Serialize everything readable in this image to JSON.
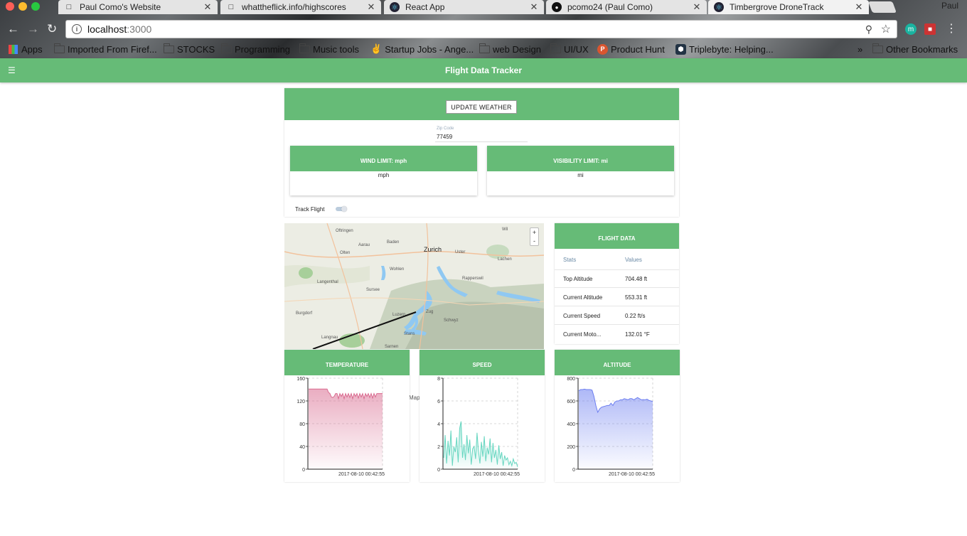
{
  "browser": {
    "tabs": [
      {
        "title": "Paul Como's Website",
        "icon": "page-icon"
      },
      {
        "title": "whattheflick.info/highscores",
        "icon": "page-icon"
      },
      {
        "title": "React App",
        "icon": "react-icon"
      },
      {
        "title": "pcomo24 (Paul Como)",
        "icon": "github-icon"
      },
      {
        "title": "Timbergrove DroneTrack",
        "icon": "react-icon"
      }
    ],
    "profile": "Paul",
    "url_host": "localhost",
    "url_port": ":3000",
    "bookmarks": [
      {
        "label": "Apps"
      },
      {
        "label": "Imported From Firef..."
      },
      {
        "label": "STOCKS"
      },
      {
        "label": "Programming"
      },
      {
        "label": "Music tools"
      },
      {
        "label": "Startup Jobs - Ange..."
      },
      {
        "label": "web Design"
      },
      {
        "label": "UI/UX"
      },
      {
        "label": "Product Hunt"
      },
      {
        "label": "Triplebyte: Helping..."
      },
      {
        "label": "»"
      },
      {
        "label": "Other Bookmarks"
      }
    ]
  },
  "app": {
    "title": "Flight Data Tracker",
    "update_button": "UPDATE WEATHER",
    "zip_label": "Zip Code",
    "zip_value": "77459",
    "wind_limit": {
      "title": "WIND LIMIT: mph",
      "unit": "mph"
    },
    "visibility_limit": {
      "title": "VISIBILITY LIMIT: mi",
      "unit": "mi"
    },
    "track_flight": "Track Flight",
    "map": {
      "zoom_in": "+",
      "zoom_out": "-",
      "attribution": "Map",
      "labels": [
        "Zurich",
        "Olten",
        "Aarau",
        "Baden",
        "Wohlen",
        "Sursee",
        "Luzern",
        "Zug",
        "Burgdorf",
        "Langnau",
        "Sarnen",
        "Schwyz",
        "Stans",
        "Uster",
        "Rapperswil",
        "Oftringen",
        "Langenthal",
        "Wil",
        "Lachen"
      ]
    },
    "flight_data": {
      "title": "FLIGHT DATA",
      "columns": [
        "Stats",
        "Values"
      ],
      "rows": [
        {
          "stat": "Top Altitude",
          "value": "704.48 ft"
        },
        {
          "stat": "Current Altitude",
          "value": "553.31 ft"
        },
        {
          "stat": "Current Speed",
          "value": "0.22 ft/s"
        },
        {
          "stat": "Current Moto...",
          "value": "132.01 °F"
        }
      ]
    },
    "temperature_title": "TEMPERATURE",
    "speed_title": "SPEED",
    "altitude_title": "ALTITUDE",
    "colors": {
      "primary": "#66bb77",
      "temp": "#d96a8f",
      "speed": "#66d6c0",
      "altitude": "#6c7ef0"
    }
  },
  "chart_data": [
    {
      "type": "area",
      "title": "TEMPERATURE",
      "x_label_single": "2017-08-10 00:42:55",
      "yticks": [
        0,
        40,
        80,
        120,
        160
      ],
      "ylim": [
        0,
        160
      ],
      "values": [
        141,
        141,
        141,
        141,
        141,
        141,
        141,
        141,
        141,
        141,
        141,
        141,
        141,
        141,
        135,
        133,
        127,
        126,
        128,
        133,
        133,
        124,
        133,
        128,
        133,
        124,
        133,
        127,
        133,
        126,
        133,
        124,
        133,
        128,
        133,
        125,
        133,
        127,
        133,
        124,
        133,
        128,
        133,
        126,
        133,
        125,
        133,
        127,
        133,
        133,
        133,
        133,
        133
      ]
    },
    {
      "type": "area",
      "title": "SPEED",
      "x_label_single": "2017-08-10 00:42:55",
      "yticks": [
        0,
        2,
        4,
        6,
        8
      ],
      "ylim": [
        0,
        8
      ],
      "values": [
        1.0,
        3.0,
        0.5,
        2.5,
        1.2,
        3.4,
        0.3,
        2.0,
        1.5,
        2.8,
        0.6,
        3.6,
        4.2,
        1.0,
        2.2,
        0.8,
        3.0,
        1.4,
        2.6,
        0.4,
        1.8,
        2.0,
        0.9,
        3.2,
        1.6,
        0.5,
        2.4,
        1.1,
        2.9,
        0.7,
        1.9,
        1.3,
        2.7,
        0.6,
        2.3,
        1.0,
        1.7,
        0.4,
        2.1,
        0.9,
        1.5,
        0.3,
        1.2,
        0.8,
        1.0,
        0.4,
        0.7,
        0.3,
        0.9,
        0.5,
        0.6,
        0.2
      ]
    },
    {
      "type": "area",
      "title": "ALTITUDE",
      "x_label_single": "2017-08-10 00:42:55",
      "yticks": [
        0,
        200,
        400,
        600,
        800
      ],
      "ylim": [
        0,
        800
      ],
      "values": [
        690,
        700,
        700,
        704,
        700,
        700,
        700,
        695,
        640,
        560,
        500,
        530,
        545,
        550,
        555,
        560,
        560,
        580,
        560,
        590,
        600,
        600,
        610,
        610,
        620,
        615,
        610,
        620,
        620,
        610,
        620,
        630,
        620,
        610,
        612,
        610,
        615,
        605,
        600,
        595
      ]
    }
  ]
}
